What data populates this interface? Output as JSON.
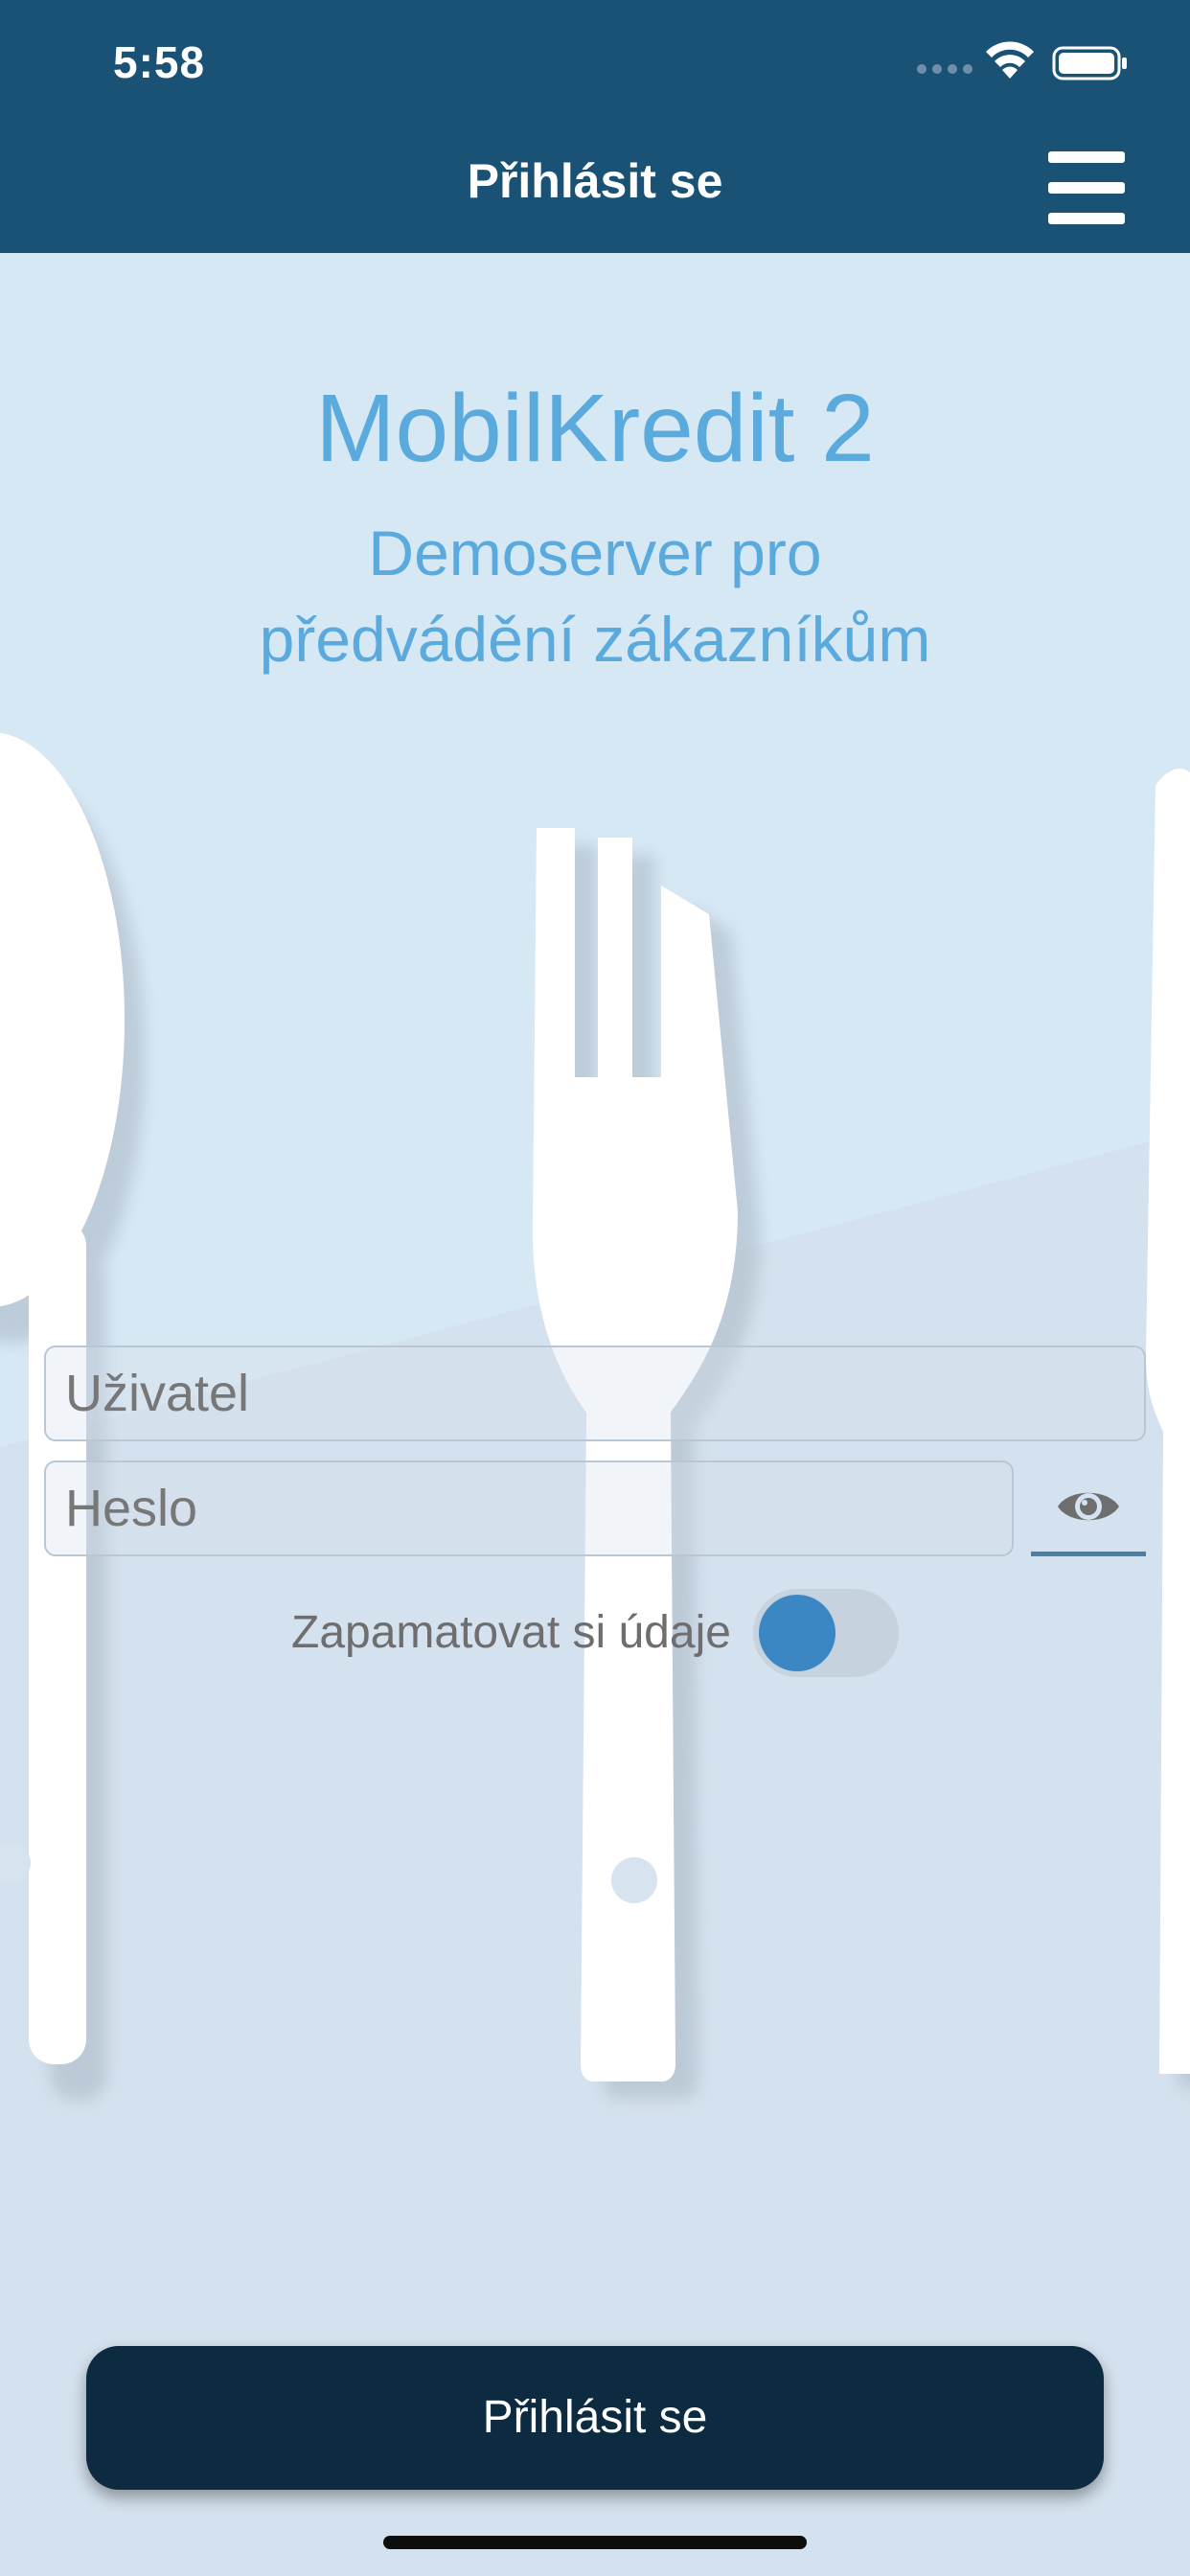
{
  "status_bar": {
    "time": "5:58",
    "icons": [
      "signal-dots-icon",
      "wifi-icon",
      "battery-icon"
    ]
  },
  "header": {
    "title": "Přihlásit se",
    "menu_icon": "hamburger-menu-icon",
    "background_color": "#1a5276"
  },
  "branding": {
    "app_title": "MobilKredit 2",
    "subtitle_line1": "Demoserver pro",
    "subtitle_line2": "předvádění zákazníkům",
    "color": "#5aaade"
  },
  "form": {
    "username_placeholder": "Uživatel",
    "username_value": "",
    "password_placeholder": "Heslo",
    "password_value": "",
    "show_password_icon": "eye-icon",
    "remember_label": "Zapamatovat si údaje",
    "remember_enabled": false,
    "toggle_color": "#3b87c4"
  },
  "login_button": {
    "label": "Přihlásit se",
    "color": "#0c2a40"
  },
  "background": {
    "illustration": "cutlery-spoon-fork-knife",
    "color": "#d5e2ef"
  }
}
